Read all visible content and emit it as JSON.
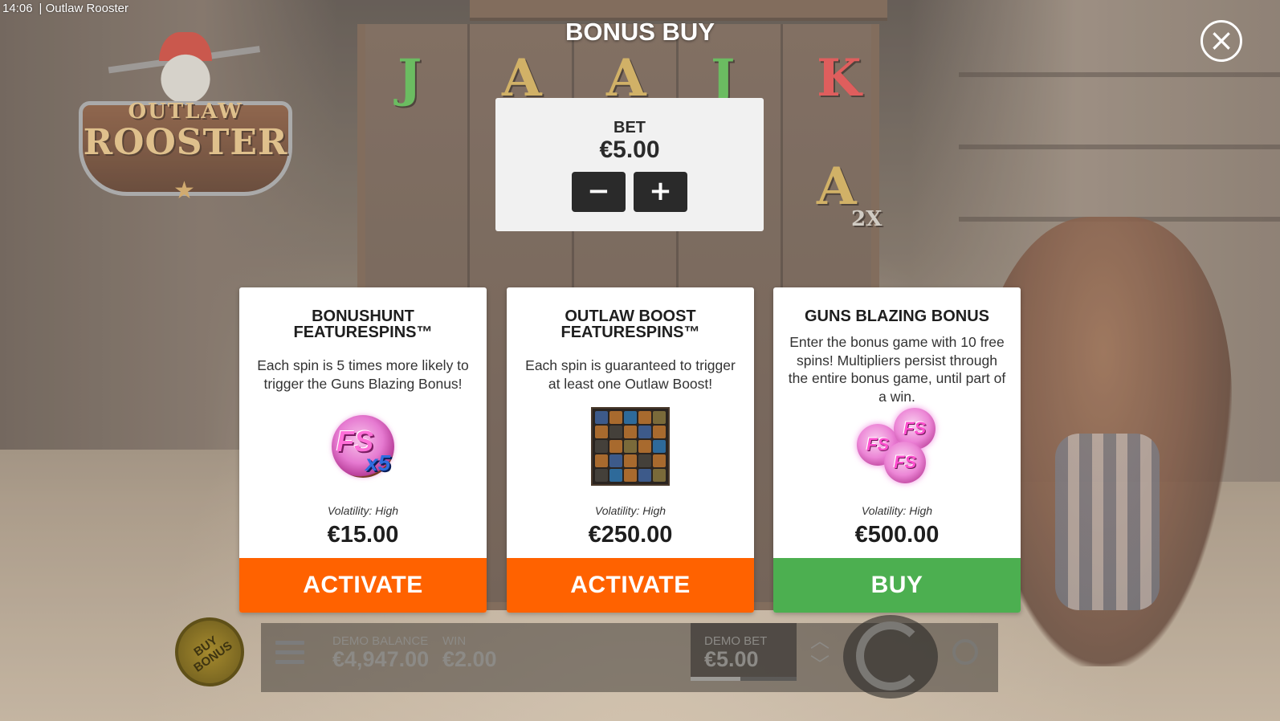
{
  "status_bar": {
    "time": "14:06",
    "app_title": "| Outlaw Rooster"
  },
  "logo": {
    "line1": "OUTLAW",
    "line2": "ROOSTER"
  },
  "reel_symbols": [
    "J",
    "A",
    "A",
    "J",
    "K",
    "A",
    "2X"
  ],
  "modal": {
    "title": "BONUS BUY",
    "close_icon": "close-icon",
    "bet": {
      "label": "BET",
      "value": "€5.00",
      "decrease": "−",
      "increase": "+"
    },
    "cards": [
      {
        "name_line1": "BONUSHUNT",
        "name_line2": "FEATURESPINS™",
        "description": "Each spin is 5 times more likely to trigger the Guns Blazing Bonus!",
        "icon": "fs-x5-coin-icon",
        "icon_text": "FS",
        "icon_multiplier": "x5",
        "volatility": "Volatility: High",
        "price": "€15.00",
        "action": "ACTIVATE",
        "action_color": "#ff6200"
      },
      {
        "name_line1": "OUTLAW BOOST",
        "name_line2": "FEATURESPINS™",
        "description": "Each spin is guaranteed to trigger at least one Outlaw Boost!",
        "icon": "reel-grid-icon",
        "volatility": "Volatility: High",
        "price": "€250.00",
        "action": "ACTIVATE",
        "action_color": "#ff6200"
      },
      {
        "name_line1": "GUNS BLAZING BONUS",
        "description": "Enter the bonus game with 10 free spins! Multipliers persist through the entire bonus game, until part of a win.",
        "icon": "triple-fs-coin-icon",
        "icon_text": "FS",
        "volatility": "Volatility: High",
        "price": "€500.00",
        "action": "BUY",
        "action_color": "#4caf50"
      }
    ]
  },
  "hud": {
    "buy_bonus": "BUY BONUS",
    "balance_label": "DEMO BALANCE",
    "balance_value": "€4,947.00",
    "win_label": "WIN",
    "win_value": "€2.00",
    "bet_label": "DEMO BET",
    "bet_value": "€5.00"
  }
}
